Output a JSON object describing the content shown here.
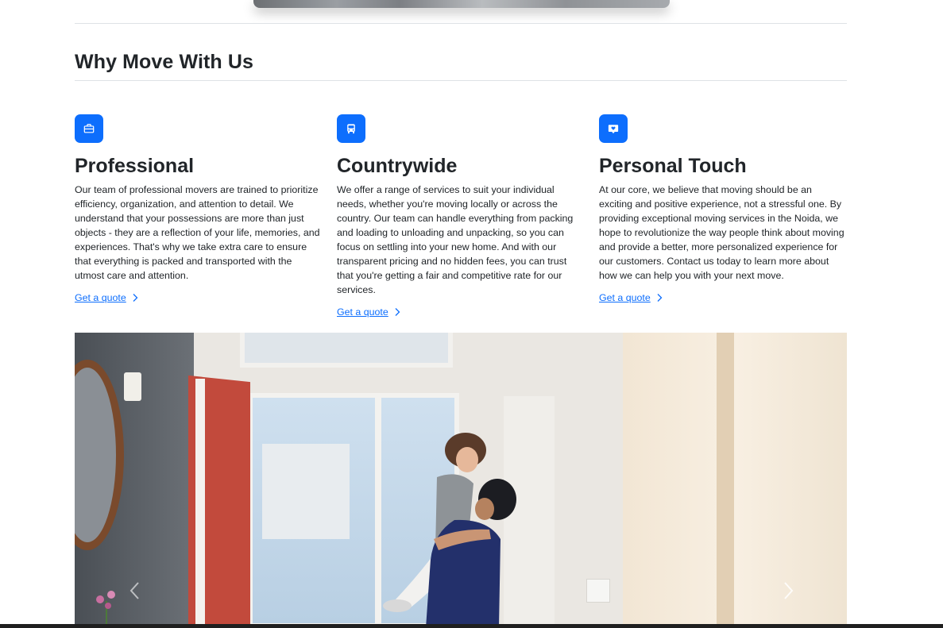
{
  "section": {
    "title": "Why Move With Us"
  },
  "features": [
    {
      "icon": "briefcase-icon",
      "title": "Professional",
      "text": "Our team of professional movers are trained to prioritize efficiency, organization, and attention to detail. We understand that your possessions are more than just objects - they are a reflection of your life, memories, and experiences. That's why we take extra care to ensure that everything is packed and transported with the utmost care and attention.",
      "link": "Get a quote"
    },
    {
      "icon": "bus-icon",
      "title": "Countrywide",
      "text": "We offer a range of services to suit your individual needs, whether you're moving locally or across the country. Our team can handle everything from packing and loading to unloading and unpacking, so you can focus on settling into your new home. And with our transparent pricing and no hidden fees, you can trust that you're getting a fair and competitive rate for our services.",
      "link": "Get a quote"
    },
    {
      "icon": "heart-chat-icon",
      "title": "Personal Touch",
      "text": "At our core, we believe that moving should be an exciting and positive experience, not a stressful one. By providing exceptional moving services in the Noida, we hope to revolutionize the way people think about moving and provide a better, more personalized experience for our customers. Contact us today to learn more about how we can help you with your next move.",
      "link": "Get a quote"
    }
  ],
  "colors": {
    "accent": "#0d6efd",
    "text": "#212529",
    "divider": "#dee2e6"
  }
}
